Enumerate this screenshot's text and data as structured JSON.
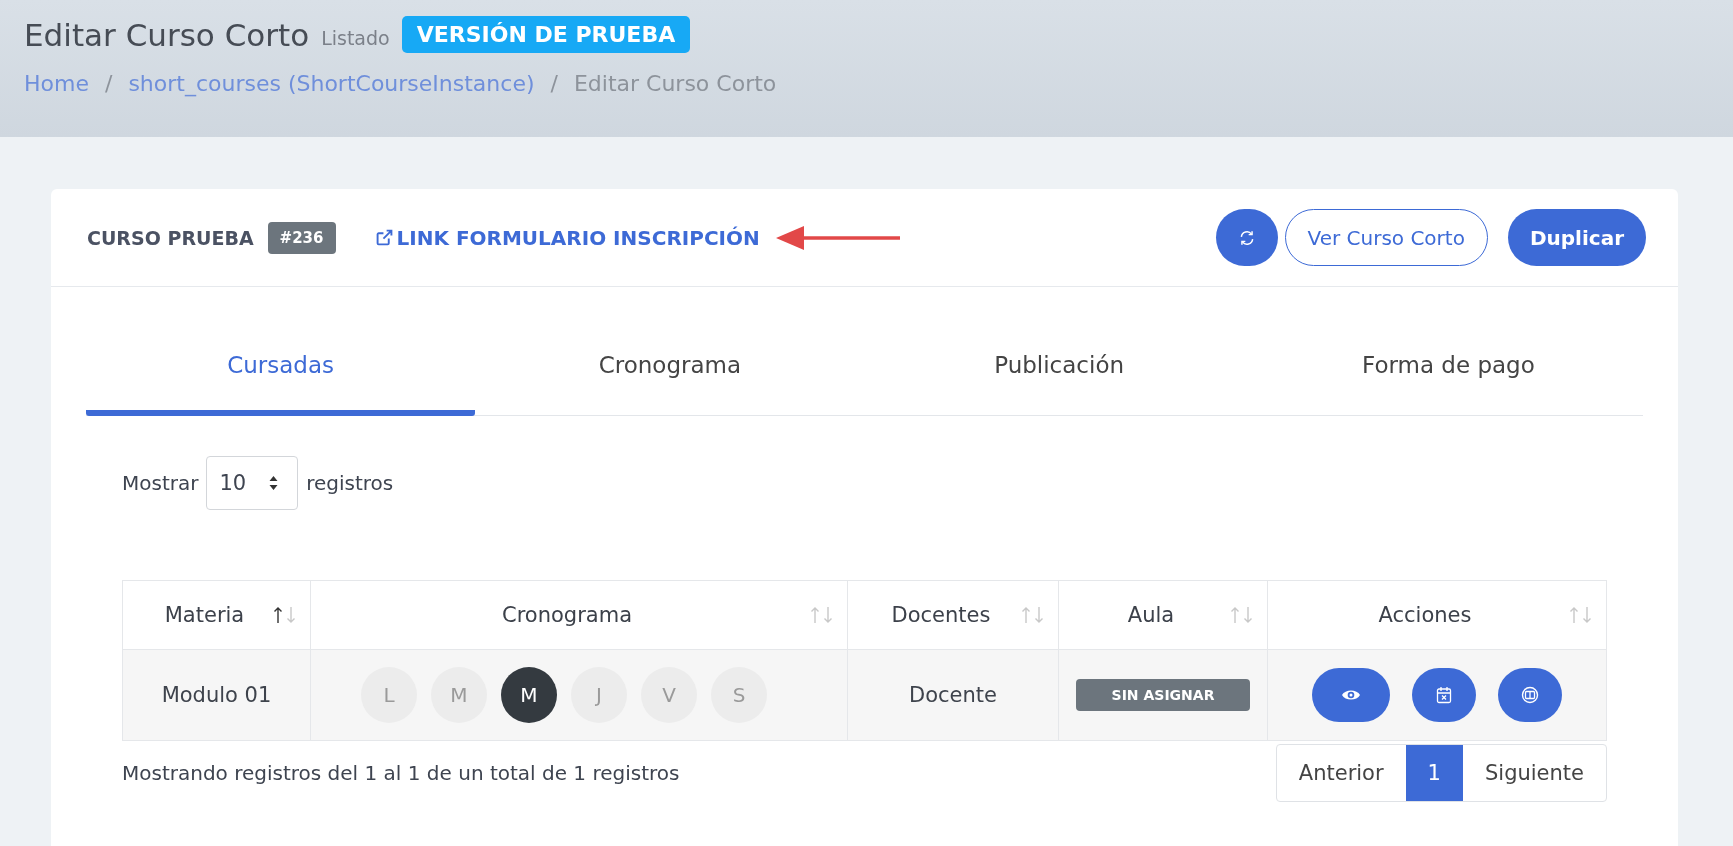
{
  "header": {
    "title": "Editar Curso Corto",
    "subtitle": "Listado",
    "badge": "VERSIÓN DE PRUEBA"
  },
  "breadcrumb": {
    "separator": "/",
    "items": [
      {
        "label": "Home",
        "link": true
      },
      {
        "label": "short_courses (ShortCourseInstance)",
        "link": true
      },
      {
        "label": "Editar Curso Corto",
        "link": false
      }
    ]
  },
  "card": {
    "title": "CURSO PRUEBA",
    "id_badge": "#236",
    "form_link": "LINK FORMULARIO INSCRIPCIÓN",
    "buttons": [
      {
        "kind": "refresh"
      },
      {
        "kind": "outline",
        "label": "Ver Curso Corto"
      },
      {
        "kind": "solid",
        "label": "Duplicar"
      }
    ]
  },
  "tabs": [
    {
      "label": "Cursadas",
      "selected": true
    },
    {
      "label": "Cronograma",
      "selected": false
    },
    {
      "label": "Publicación",
      "selected": false
    },
    {
      "label": "Forma de pago",
      "selected": false
    }
  ],
  "length": {
    "before": "Mostrar",
    "value": "10",
    "after": "registros"
  },
  "table": {
    "columns": [
      {
        "label": "Materia",
        "sorted_ascending": true
      },
      {
        "label": "Cronograma",
        "sorted_ascending": false
      },
      {
        "label": "Docentes",
        "sorted_ascending": false
      },
      {
        "label": "Aula",
        "sorted_ascending": false
      },
      {
        "label": "Acciones",
        "sorted_ascending": false
      }
    ],
    "rows": [
      {
        "materia": "Modulo 01",
        "days": [
          {
            "label": "L",
            "selected": false
          },
          {
            "label": "M",
            "selected": false
          },
          {
            "label": "M",
            "selected": true
          },
          {
            "label": "J",
            "selected": false
          },
          {
            "label": "V",
            "selected": false
          },
          {
            "label": "S",
            "selected": false
          }
        ],
        "docentes": "Docente",
        "aula": "SIN ASIGNAR",
        "actions": [
          {
            "kind": "view"
          },
          {
            "kind": "calendar"
          },
          {
            "kind": "book"
          }
        ]
      }
    ]
  },
  "info": "Mostrando registros del 1 al 1 de un total de 1 registros",
  "pagination": [
    {
      "label": "Anterior",
      "selected": false
    },
    {
      "label": "1",
      "selected": true
    },
    {
      "label": "Siguiente",
      "selected": false
    }
  ]
}
